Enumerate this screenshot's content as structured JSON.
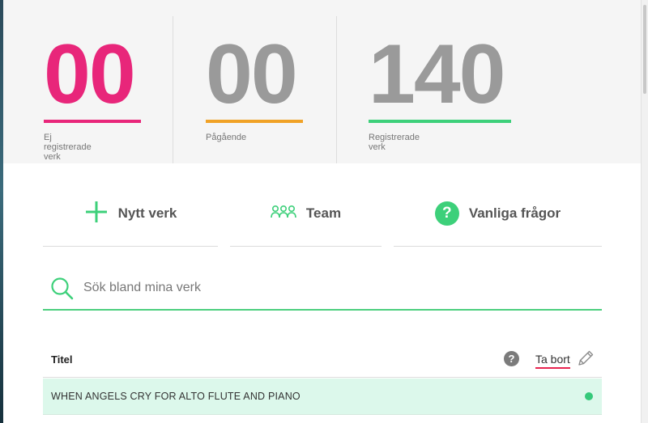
{
  "stats": [
    {
      "value": "00",
      "label": "Ej registrerade verk",
      "color": "#e8267a"
    },
    {
      "value": "00",
      "label": "Pågående",
      "color": "#f0a227"
    },
    {
      "value": "140",
      "label": "Registrerade verk",
      "color": "#3dd07a"
    }
  ],
  "stat_number_color_muted": "#9a9a9a",
  "actions": {
    "new_work": {
      "label": "Nytt verk",
      "icon": "plus-icon"
    },
    "team": {
      "label": "Team",
      "icon": "people-icon"
    },
    "faq": {
      "label": "Vanliga frågor",
      "icon": "question-icon",
      "glyph": "?"
    }
  },
  "search": {
    "placeholder": "Sök bland mina verk",
    "value": ""
  },
  "table": {
    "header": {
      "title": "Titel",
      "help_glyph": "?",
      "remove_label": "Ta bort"
    },
    "rows": [
      {
        "title": "WHEN ANGELS CRY FOR ALTO FLUTE AND PIANO",
        "status_color": "#35c97a"
      }
    ]
  },
  "accent_color": "#3dd07a"
}
